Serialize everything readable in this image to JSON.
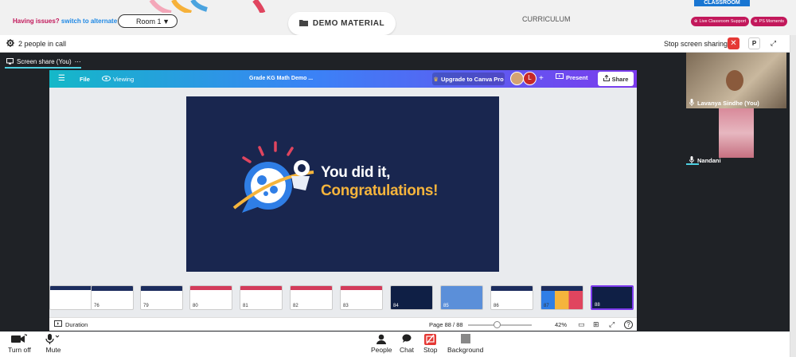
{
  "topbar": {
    "issue_text": "Having issues?",
    "alt_room_link": "switch to alternate room",
    "room_label": "Room 1",
    "demo_material": "DEMO MATERIAL",
    "curriculum": "CURRICULUM",
    "classroom": "CLASSROOM",
    "live_support": "Live Classroom Support",
    "ps_moments": "PS Moments"
  },
  "meeting": {
    "people_in_call": "2 people in call",
    "stop_sharing": "Stop screen sharing",
    "p_button": "P",
    "screen_share_tab": "Screen share (You)"
  },
  "canva": {
    "file": "File",
    "viewing": "Viewing",
    "doc_title": "Grade KG Math Demo ...",
    "upgrade": "Upgrade to Canva Pro",
    "avatar_letter": "L",
    "present": "Present",
    "share": "Share",
    "slide_line1": "You did it,",
    "slide_line2": "Congratulations!",
    "duration": "Duration",
    "page": "Page 88 / 88",
    "zoom": "42%",
    "zoom_fraction": 0.42,
    "thumbnails": [
      "76",
      "79",
      "80",
      "81",
      "82",
      "83",
      "84",
      "85",
      "86",
      "87",
      "88"
    ],
    "current_thumbnail": "88"
  },
  "participants": [
    {
      "name": "Lavanya Sindhe (You)"
    },
    {
      "name": "Nandani"
    }
  ],
  "toolbar": {
    "turn_off": "Turn off",
    "mute": "Mute",
    "people": "People",
    "chat": "Chat",
    "stop": "Stop",
    "background": "Background"
  },
  "colors": {
    "accent_pink": "#c2185b",
    "link_blue": "#1e88e5",
    "stop_red": "#e53935",
    "slide_bg": "#19264f",
    "congrats_gold": "#f5b43c"
  }
}
